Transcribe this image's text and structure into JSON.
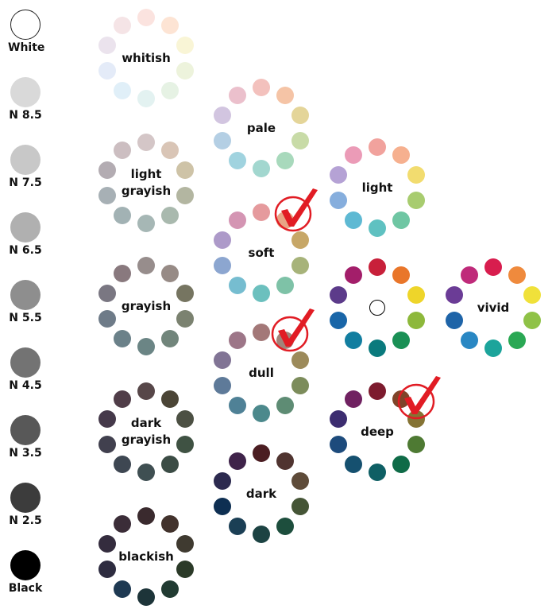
{
  "neutrals": [
    {
      "label": "White",
      "color": "#ffffff"
    },
    {
      "label": "N 8.5",
      "color": "#d9d9d9"
    },
    {
      "label": "N 7.5",
      "color": "#c8c8c8"
    },
    {
      "label": "N 6.5",
      "color": "#b0b0b0"
    },
    {
      "label": "N 5.5",
      "color": "#8e8e8e"
    },
    {
      "label": "N 4.5",
      "color": "#737373"
    },
    {
      "label": "N 3.5",
      "color": "#585858"
    },
    {
      "label": "N 2.5",
      "color": "#3c3c3c"
    },
    {
      "label": "Black",
      "color": "#000000"
    }
  ],
  "tones": [
    {
      "name": "whitish",
      "label": "whitish",
      "colors": [
        "#fbe3df",
        "#fde4d4",
        "#f9f5d6",
        "#edf3dc",
        "#e6f2e4",
        "#e3f2f1",
        "#e0eff8",
        "#e4ebf8",
        "#ebe3ed",
        "#f5e4e6"
      ]
    },
    {
      "name": "light-grayish",
      "label": "light\ngrayish",
      "colors": [
        "#d4c6c7",
        "#d9c5b6",
        "#cec3a7",
        "#b3b6a1",
        "#a9b9ae",
        "#a6b7b5",
        "#a2b2b4",
        "#a7b0b5",
        "#b3acb2",
        "#ccbec1"
      ]
    },
    {
      "name": "grayish",
      "label": "grayish",
      "colors": [
        "#978d8c",
        "#978b86",
        "#767561",
        "#7b8270",
        "#71857b",
        "#6b8585",
        "#6b8189",
        "#6e7b88",
        "#7a7782",
        "#89797e"
      ]
    },
    {
      "name": "dark-grayish",
      "label": "dark\ngrayish",
      "colors": [
        "#574749",
        "#4b4536",
        "#4c5043",
        "#3f5243",
        "#3b4c45",
        "#3f4f52",
        "#3e4752",
        "#41404e",
        "#45394a",
        "#503d48"
      ]
    },
    {
      "name": "blackish",
      "label": "blackish",
      "colors": [
        "#3a2a2e",
        "#42322c",
        "#3f3a30",
        "#2b3a28",
        "#213b32",
        "#1d3439",
        "#1e3952",
        "#2e2c40",
        "#342c3e",
        "#3b2d38"
      ]
    },
    {
      "name": "pale",
      "label": "pale",
      "colors": [
        "#f3c1bd",
        "#f5c4a6",
        "#e4d599",
        "#c8dba7",
        "#a8d9bc",
        "#a2d7cf",
        "#a0d3df",
        "#b4cfe4",
        "#d2c5e0",
        "#ebc0cc"
      ]
    },
    {
      "name": "soft",
      "label": "soft",
      "colors": [
        "#e59a9d",
        "#e8a485",
        "#c7a767",
        "#a7b37a",
        "#7ec2a7",
        "#6cc0be",
        "#76bdd0",
        "#8ca6d0",
        "#ad9ac9",
        "#d495b3"
      ]
    },
    {
      "name": "dull",
      "label": "dull",
      "colors": [
        "#a37878",
        "#a1847a",
        "#9c8a5a",
        "#7c8c5b",
        "#5e8c74",
        "#4c898c",
        "#4f8196",
        "#5e7a99",
        "#817495",
        "#9d7688"
      ]
    },
    {
      "name": "dark",
      "label": "dark",
      "colors": [
        "#4b1d22",
        "#503430",
        "#5e4b39",
        "#455536",
        "#1d4e3d",
        "#1c4343",
        "#1b3f55",
        "#0e2f52",
        "#2c2a4f",
        "#3f234a"
      ]
    },
    {
      "name": "light",
      "label": "light",
      "colors": [
        "#f1a29d",
        "#f6b08f",
        "#f2dc6f",
        "#a8cc6f",
        "#6fc6a3",
        "#5fc1c1",
        "#5eb9d3",
        "#86aedd",
        "#b5a2d5",
        "#eb9bb7"
      ]
    },
    {
      "name": "center",
      "label": "",
      "colors": [
        "#c8203a",
        "#e9762a",
        "#eed52a",
        "#8db83b",
        "#1a9055",
        "#0a7a7d",
        "#127ea0",
        "#1966a8",
        "#5c3b8a",
        "#a31e6a"
      ]
    },
    {
      "name": "deep",
      "label": "deep",
      "colors": [
        "#7d1b2e",
        "#7f4429",
        "#857334",
        "#4e7a33",
        "#0f6b48",
        "#0e5f64",
        "#15506f",
        "#1d4b7c",
        "#3c2d70",
        "#702161"
      ]
    },
    {
      "name": "vivid",
      "label": "vivid",
      "colors": [
        "#d81d4e",
        "#ef8a3d",
        "#f0e13a",
        "#8fc247",
        "#2aa854",
        "#1ca49b",
        "#2987c3",
        "#1e64a8",
        "#6b3c96",
        "#bf2a7a"
      ]
    }
  ],
  "checkmark_color": "#e11c24"
}
